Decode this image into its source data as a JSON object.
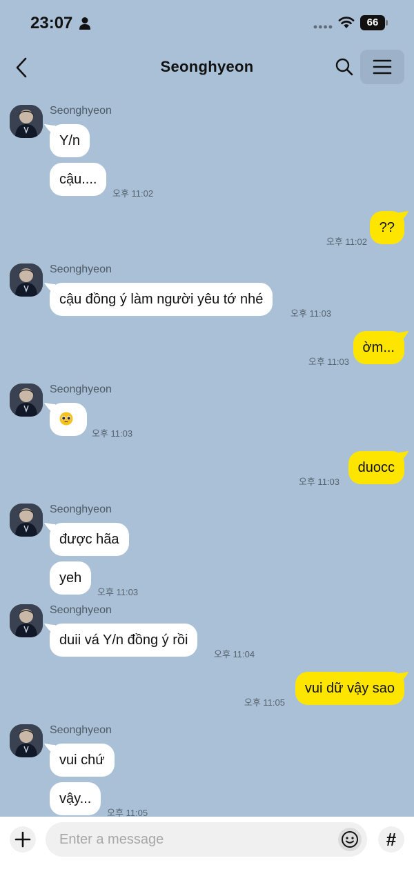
{
  "status_bar": {
    "time": "23:07",
    "battery": "66"
  },
  "header": {
    "title": "Seonghyeon"
  },
  "chat": {
    "g1": {
      "sender": "Seonghyeon",
      "m1": "Y/n",
      "m2": "cậu....",
      "time": "오후 11:02"
    },
    "o1": {
      "text": "??",
      "time": "오후 11:02"
    },
    "g2": {
      "sender": "Seonghyeon",
      "m1": "cậu đồng ý làm người yêu tớ nhé",
      "time": "오후 11:03"
    },
    "o2": {
      "text": "ờm...",
      "time": "오후 11:03"
    },
    "g3": {
      "sender": "Seonghyeon",
      "time": "오후 11:03"
    },
    "o3": {
      "text": "duocc",
      "time": "오후 11:03"
    },
    "g4": {
      "sender": "Seonghyeon",
      "m1": "được hãa",
      "m2": "yeh",
      "time": "오후 11:03"
    },
    "g5": {
      "sender": "Seonghyeon",
      "m1": "duii vá Y/n đồng ý rồi",
      "time": "오후 11:04"
    },
    "o4": {
      "text": "vui dữ vậy sao",
      "time": "오후 11:05"
    },
    "g6": {
      "sender": "Seonghyeon",
      "m1": "vui chứ",
      "m2": "vậy...",
      "time": "오후 11:05"
    }
  },
  "input": {
    "placeholder": "Enter a message",
    "hash_label": "#"
  },
  "colors": {
    "background": "#aac0d6",
    "outgoing_bubble": "#fee500",
    "incoming_bubble": "#ffffff"
  }
}
